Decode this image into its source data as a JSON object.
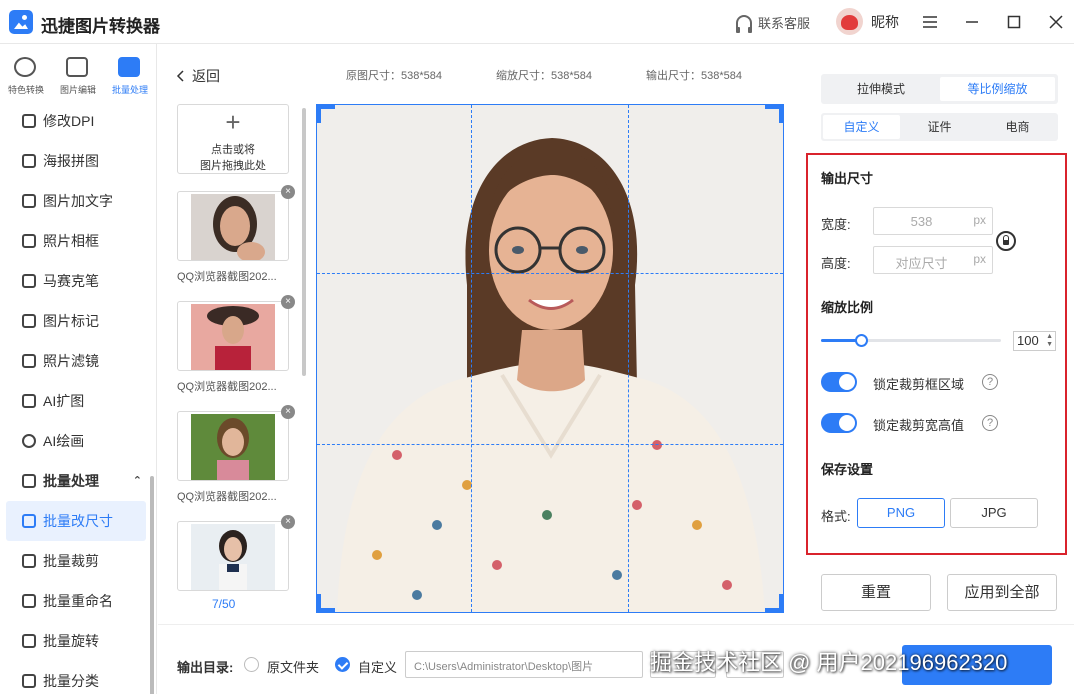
{
  "app": {
    "title": "迅捷图片转换器",
    "support": "联系客服",
    "nickname": "昵称",
    "menu_icon": "hamburger-icon",
    "minimize_icon": "minimize-icon",
    "maximize_icon": "maximize-icon",
    "close_icon": "close-icon"
  },
  "topnav": [
    {
      "label": "特色转换",
      "icon": "convert-icon"
    },
    {
      "label": "图片编辑",
      "icon": "image-edit-icon"
    },
    {
      "label": "批量处理",
      "icon": "batch-icon",
      "active": true
    }
  ],
  "sidebar": {
    "items": [
      {
        "label": "修改DPI",
        "icon": "dpi-icon"
      },
      {
        "label": "海报拼图",
        "icon": "collage-icon"
      },
      {
        "label": "图片加文字",
        "icon": "add-text-icon"
      },
      {
        "label": "照片相框",
        "icon": "frame-icon"
      },
      {
        "label": "马赛克笔",
        "icon": "mosaic-icon"
      },
      {
        "label": "图片标记",
        "icon": "mark-icon"
      },
      {
        "label": "照片滤镜",
        "icon": "filter-icon"
      },
      {
        "label": "AI扩图",
        "icon": "ai-expand-icon"
      },
      {
        "label": "AI绘画",
        "icon": "ai-paint-icon"
      },
      {
        "label": "批量处理",
        "icon": "batch-section-icon",
        "section": true
      },
      {
        "label": "批量改尺寸",
        "icon": "resize-icon",
        "active": true
      },
      {
        "label": "批量裁剪",
        "icon": "crop-icon"
      },
      {
        "label": "批量重命名",
        "icon": "rename-icon"
      },
      {
        "label": "批量旋转",
        "icon": "rotate-icon"
      },
      {
        "label": "批量分类",
        "icon": "classify-icon"
      }
    ]
  },
  "filelist": {
    "back": "返回",
    "add_line1": "点击或将",
    "add_line2": "图片拖拽此处",
    "items": [
      {
        "name": "QQ浏览器截图202..."
      },
      {
        "name": "QQ浏览器截图202..."
      },
      {
        "name": "QQ浏览器截图202..."
      },
      {
        "name": ""
      }
    ],
    "page": "7/50"
  },
  "sizes": {
    "original": "原图尺寸：538*584",
    "scaled": "缩放尺寸：538*584",
    "output": "输出尺寸：538*584"
  },
  "panel": {
    "mode_tabs": [
      "拉伸模式",
      "等比例缩放"
    ],
    "preset_tabs": [
      "自定义",
      "证件",
      "电商"
    ],
    "output_size_title": "输出尺寸",
    "width_label": "宽度:",
    "width_value": "538",
    "height_label": "高度:",
    "height_value": "对应尺寸",
    "unit": "px",
    "scale_title": "缩放比例",
    "scale_value": "100",
    "scale_fraction": 0.22,
    "lock_crop_label": "锁定裁剪框区域",
    "lock_ratio_label": "锁定裁剪宽高值",
    "save_title": "保存设置",
    "format_label": "格式:",
    "formats": [
      "PNG",
      "JPG"
    ],
    "reset": "重置",
    "apply_all": "应用到全部"
  },
  "bottom": {
    "output_dir_label": "输出目录:",
    "option_source": "原文件夹",
    "option_custom": "自定义",
    "path": "C:\\Users\\Administrator\\Desktop\\图片",
    "watermark": "掘金技术社区 @ 用户2021969623​20"
  }
}
